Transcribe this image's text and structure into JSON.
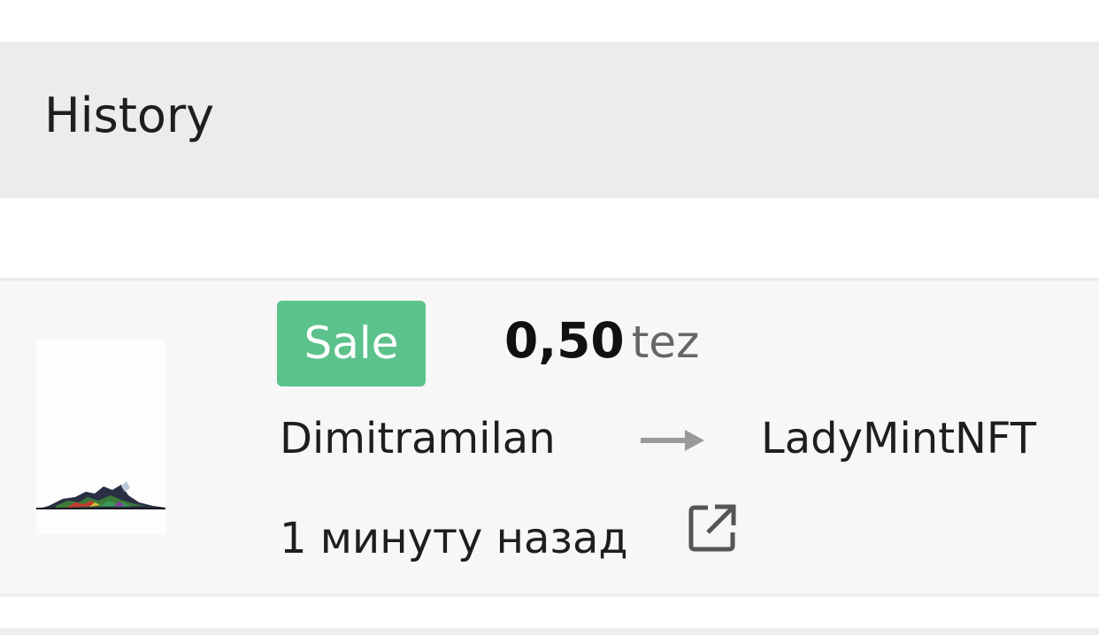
{
  "header": {
    "title": "History"
  },
  "history": {
    "items": [
      {
        "event": "Sale",
        "price": "0,50",
        "currency": "tez",
        "from": "Dimitramilan",
        "to": "LadyMintNFT",
        "time": "1 минуту назад",
        "badge_color": "#5cc28c",
        "icons": [
          "artwork-thumbnail",
          "arrow-right-icon",
          "external-link-icon"
        ]
      }
    ]
  }
}
